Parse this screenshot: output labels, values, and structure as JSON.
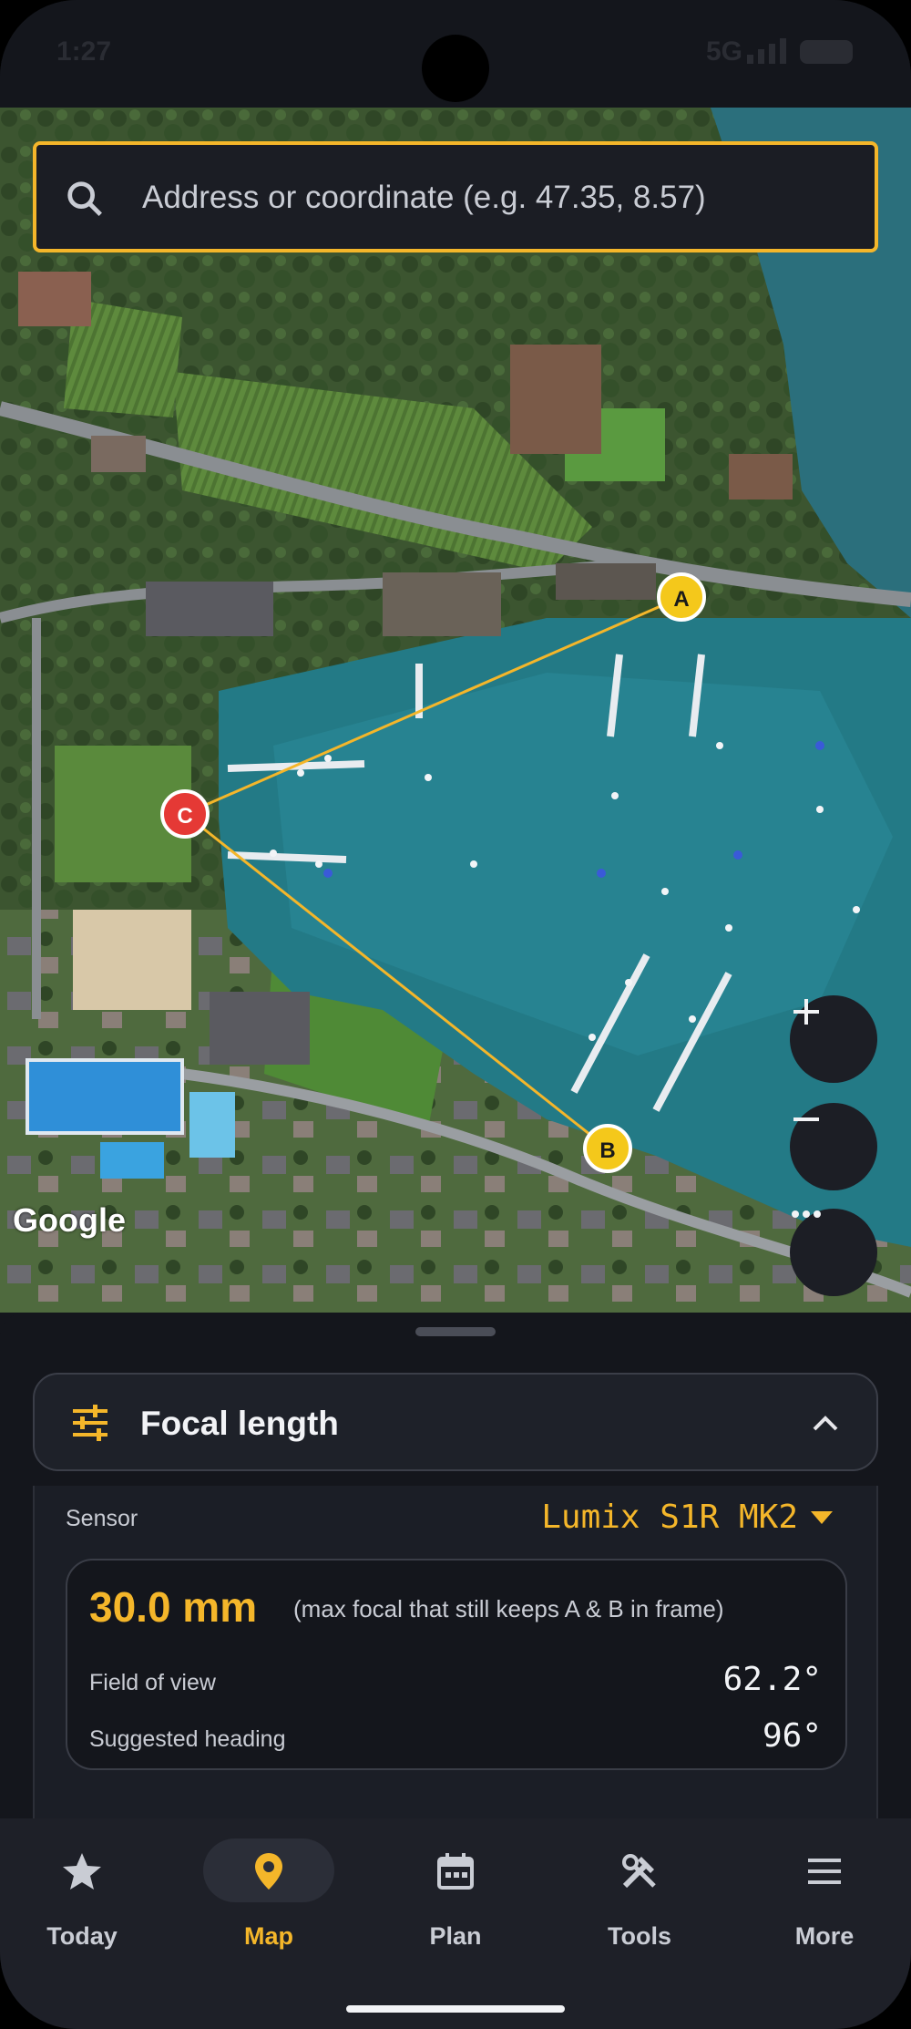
{
  "status": {
    "time": "1:27",
    "network": "5G"
  },
  "search": {
    "placeholder": "Address or coordinate (e.g. 47.35, 8.57)"
  },
  "map": {
    "attribution": "Google",
    "markers": [
      {
        "id": "A",
        "color": "#f4c81b"
      },
      {
        "id": "B",
        "color": "#f4c81b"
      },
      {
        "id": "C",
        "color": "#e53935"
      }
    ],
    "line_color": "#f4b62a"
  },
  "sheet": {
    "section_title": "Focal length",
    "sensor_label": "Sensor",
    "sensor_value": "Lumix S1R MK2",
    "focal_value": "30.0 mm",
    "focal_note": "(max focal that still keeps A & B in frame)",
    "fov_label": "Field of view",
    "fov_value": "62.2°",
    "heading_label": "Suggested heading",
    "heading_value": "96°"
  },
  "nav": {
    "items": [
      {
        "label": "Today",
        "icon": "star-icon"
      },
      {
        "label": "Map",
        "icon": "map-pin-icon",
        "active": true
      },
      {
        "label": "Plan",
        "icon": "calendar-icon"
      },
      {
        "label": "Tools",
        "icon": "tools-icon"
      },
      {
        "label": "More",
        "icon": "menu-icon"
      }
    ]
  },
  "colors": {
    "accent": "#f4b62a",
    "background": "#14161c",
    "surface": "#1e2129"
  }
}
